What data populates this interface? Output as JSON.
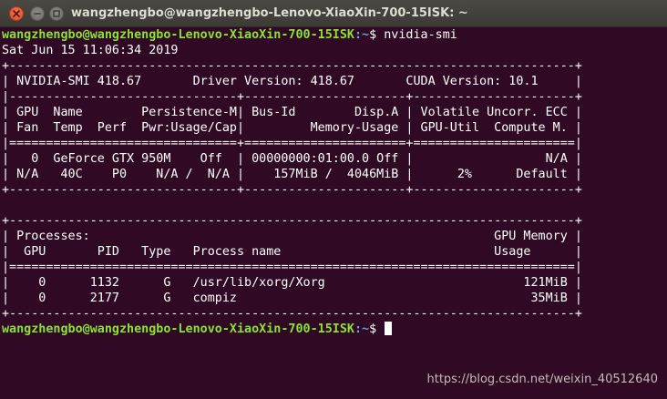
{
  "window": {
    "title": "wangzhengbo@wangzhengbo-Lenovo-XiaoXin-700-15ISK: ~"
  },
  "terminal": {
    "prompt1": {
      "user_host": "wangzhengbo@wangzhengbo-Lenovo-XiaoXin-700-15ISK",
      "path": ":~",
      "symbol": "$ ",
      "command": "nvidia-smi"
    },
    "date_line": "Sat Jun 15 11:06:34 2019",
    "output_lines": [
      "+-----------------------------------------------------------------------------+",
      "| NVIDIA-SMI 418.67       Driver Version: 418.67       CUDA Version: 10.1     |",
      "|-------------------------------+----------------------+----------------------+",
      "| GPU  Name        Persistence-M| Bus-Id        Disp.A | Volatile Uncorr. ECC |",
      "| Fan  Temp  Perf  Pwr:Usage/Cap|         Memory-Usage | GPU-Util  Compute M. |",
      "|===============================+======================+======================|",
      "|   0  GeForce GTX 950M    Off  | 00000000:01:00.0 Off |                  N/A |",
      "| N/A   40C    P0    N/A /  N/A |    157MiB /  4046MiB |      2%      Default |",
      "+-------------------------------+----------------------+----------------------+",
      "",
      "+-----------------------------------------------------------------------------+",
      "| Processes:                                                       GPU Memory |",
      "|  GPU       PID   Type   Process name                             Usage      |",
      "|=============================================================================|",
      "|    0      1132      G   /usr/lib/xorg/Xorg                           121MiB |",
      "|    0      2177      G   compiz                                        35MiB |",
      "+-----------------------------------------------------------------------------+"
    ],
    "prompt2": {
      "user_host": "wangzhengbo@wangzhengbo-Lenovo-XiaoXin-700-15ISK",
      "path": ":~",
      "symbol": "$ "
    }
  },
  "watermark": "https://blog.csdn.net/weixin_40512640",
  "colors": {
    "background": "#300a24",
    "prompt_user": "#8ae234",
    "prompt_path": "#729fcf",
    "text": "#ffffff",
    "close_button": "#e0542b"
  }
}
